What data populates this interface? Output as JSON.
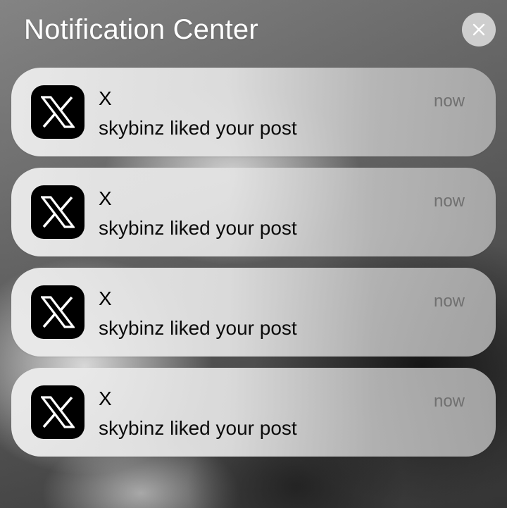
{
  "header": {
    "title": "Notification Center",
    "close_icon": "close-icon"
  },
  "notifications": [
    {
      "app_name": "X",
      "message": "skybinz liked your post",
      "time": "now",
      "icon": "x-logo-icon"
    },
    {
      "app_name": "X",
      "message": "skybinz liked your post",
      "time": "now",
      "icon": "x-logo-icon"
    },
    {
      "app_name": "X",
      "message": "skybinz liked your post",
      "time": "now",
      "icon": "x-logo-icon"
    },
    {
      "app_name": "X",
      "message": "skybinz liked your post",
      "time": "now",
      "icon": "x-logo-icon"
    }
  ],
  "colors": {
    "card_background": "#e6e6e6",
    "app_icon_background": "#000000",
    "title_text": "#ffffff",
    "time_text": "#707070"
  }
}
